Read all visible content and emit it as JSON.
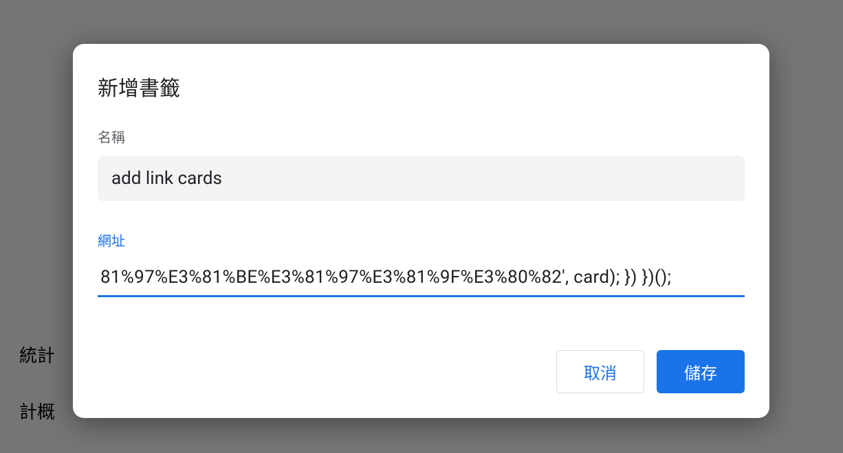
{
  "background": {
    "text1": "統計",
    "text2": "計概"
  },
  "modal": {
    "title": "新增書籤",
    "name_field": {
      "label": "名稱",
      "value": "add link cards"
    },
    "url_field": {
      "label": "網址",
      "value": "81%97%E3%81%BE%E3%81%97%E3%81%9F%E3%80%82', card); }) })();"
    },
    "buttons": {
      "cancel": "取消",
      "save": "儲存"
    }
  }
}
